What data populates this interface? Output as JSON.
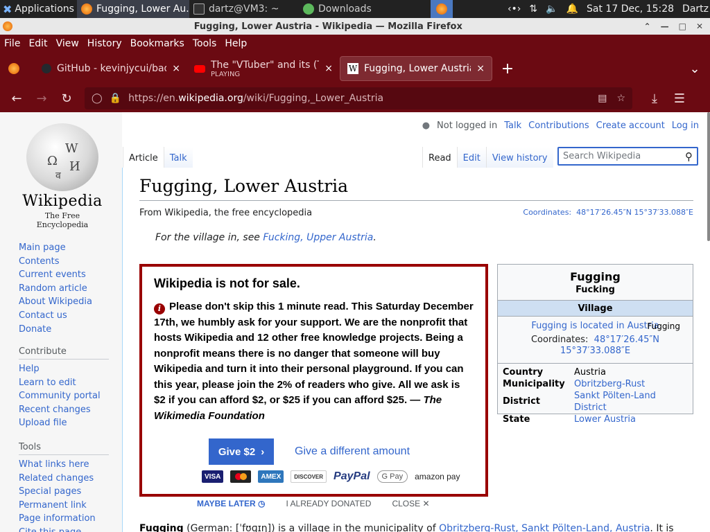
{
  "taskbar": {
    "apps_label": "Applications",
    "tasks": [
      {
        "label": "Fugging, Lower Au..."
      },
      {
        "label": "dartz@VM3: ~"
      },
      {
        "label": "Downloads"
      }
    ],
    "clock": "Sat 17 Dec, 15:28",
    "user": "Dartz"
  },
  "window": {
    "title": "Fugging, Lower Austria - Wikipedia — Mozilla Firefox"
  },
  "menu": [
    "File",
    "Edit",
    "View",
    "History",
    "Bookmarks",
    "Tools",
    "Help"
  ],
  "tabs": [
    {
      "label": "GitHub - kevinjycui/bad-a",
      "close": "×"
    },
    {
      "label": "The \"VTuber\" and its (Tec",
      "sub": "PLAYING",
      "close": "×"
    },
    {
      "label": "Fugging, Lower Austria -",
      "close": "×"
    }
  ],
  "url": {
    "prefix": "https://en.",
    "host": "wikipedia.org",
    "path": "/wiki/Fugging,_Lower_Austria"
  },
  "wiki": {
    "wordmark": "Wikipedia",
    "tagline": "The Free Encyclopedia",
    "nav": [
      "Main page",
      "Contents",
      "Current events",
      "Random article",
      "About Wikipedia",
      "Contact us",
      "Donate"
    ],
    "contribute_heading": "Contribute",
    "contribute": [
      "Help",
      "Learn to edit",
      "Community portal",
      "Recent changes",
      "Upload file"
    ],
    "tools_heading": "Tools",
    "tools": [
      "What links here",
      "Related changes",
      "Special pages",
      "Permanent link",
      "Page information",
      "Cite this page"
    ],
    "personal": {
      "not_logged": "Not logged in",
      "links": [
        "Talk",
        "Contributions",
        "Create account",
        "Log in"
      ]
    },
    "tabs_left": [
      "Article",
      "Talk"
    ],
    "tabs_right": [
      "Read",
      "Edit",
      "View history"
    ],
    "search_placeholder": "Search Wikipedia",
    "heading": "Fugging, Lower Austria",
    "from": "From Wikipedia, the free encyclopedia",
    "coords_label": "Coordinates:",
    "coords": "48°17′26.45″N 15°37′33.088″E",
    "hatnote_prefix": "For the village in, see ",
    "hatnote_link": "Fucking, Upper Austria",
    "hatnote_suffix": ".",
    "body_bold": "Fugging",
    "body_rest": " (German: [ˈfʊɡɪŋ]) is a village in the municipality of ",
    "body_link": "Obritzberg-Rust, Sankt Pölten-Land, Austria",
    "body_tail": ". It is"
  },
  "banner": {
    "title": "Wikipedia is not for sale.",
    "text": "Please don't skip this 1 minute read. This Saturday December 17th, we humbly ask for your support. We are the nonprofit that hosts Wikipedia and 12 other free knowledge projects. Being a nonprofit means there is no danger that someone will buy Wikipedia and turn it into their personal playground. If you can this year, please join the 2% of readers who give. All we ask is $2 if you can afford $2, or $25 if you can afford $25. — ",
    "signature": "The Wikimedia Foundation",
    "give_label": "Give $2",
    "other_label": "Give a different amount",
    "payments": [
      "VISA",
      "Mastercard",
      "AMEX",
      "DISCOVER",
      "PayPal",
      "G Pay",
      "amazon pay"
    ],
    "maybe_later": "MAYBE LATER",
    "already": "I ALREADY DONATED",
    "close": "CLOSE"
  },
  "infobox": {
    "title": "Fugging",
    "subtitle": "Fucking",
    "type": "Village",
    "map_link": "Fugging is located in Austria",
    "map_overlay": "Fugging",
    "coords_label": "Coordinates:",
    "coords": "48°17′26.45″N 15°37′33.088″E",
    "rows": [
      {
        "k": "Country",
        "v": "Austria",
        "link": false
      },
      {
        "k": "Municipality",
        "v": "Obritzberg-Rust",
        "link": true
      },
      {
        "k": "District",
        "v": "Sankt Pölten-Land District",
        "link": true
      },
      {
        "k": "State",
        "v": "Lower Austria",
        "link": true
      }
    ]
  }
}
